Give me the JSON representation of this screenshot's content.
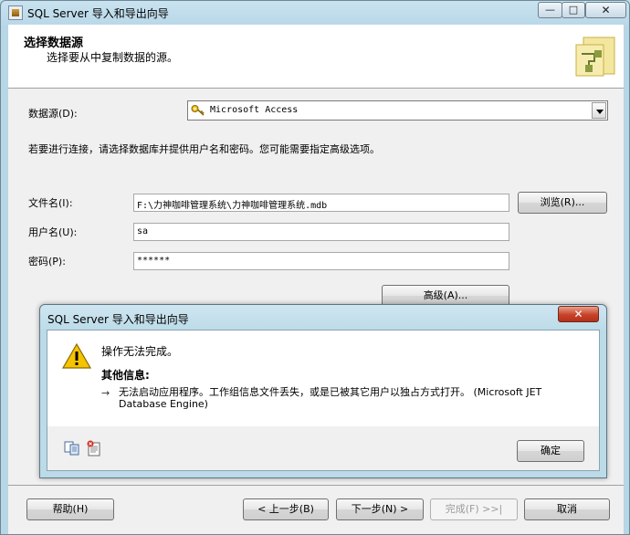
{
  "window": {
    "title": "SQL Server 导入和导出向导"
  },
  "header": {
    "title": "选择数据源",
    "subtitle": "选择要从中复制数据的源。"
  },
  "form": {
    "datasource_label": "数据源(D):",
    "datasource_value": "Microsoft Access",
    "hint": "若要进行连接，请选择数据库并提供用户名和密码。您可能需要指定高级选项。",
    "filename_label": "文件名(I):",
    "filename_value": "F:\\力神咖啡管理系统\\力神咖啡管理系统.mdb",
    "browse_label": "浏览(R)...",
    "username_label": "用户名(U):",
    "username_value": "sa",
    "password_label": "密码(P):",
    "password_value": "******",
    "advanced_label": "高级(A)..."
  },
  "footer": {
    "help": "帮助(H)",
    "back": "< 上一步(B)",
    "next": "下一步(N) >",
    "finish": "完成(F) >>|",
    "cancel": "取消"
  },
  "dialog": {
    "title": "SQL Server 导入和导出向导",
    "close_glyph": "✕",
    "message": "操作无法完成。",
    "extra_heading": "其他信息:",
    "arrow_glyph": "→",
    "detail": "无法启动应用程序。工作组信息文件丢失，或是已被其它用户以独占方式打开。 (Microsoft JET Database Engine)",
    "ok": "确定"
  },
  "colors": {
    "frame": "#b7d6e6",
    "client": "#f0f0f0",
    "close_red": "#c7432a",
    "warning_yellow": "#f5c400"
  },
  "icons": [
    "app-icon",
    "wizard-graphic",
    "key-icon",
    "chevron-down-icon",
    "warning-icon",
    "copy-icon",
    "details-icon",
    "close-icon"
  ]
}
